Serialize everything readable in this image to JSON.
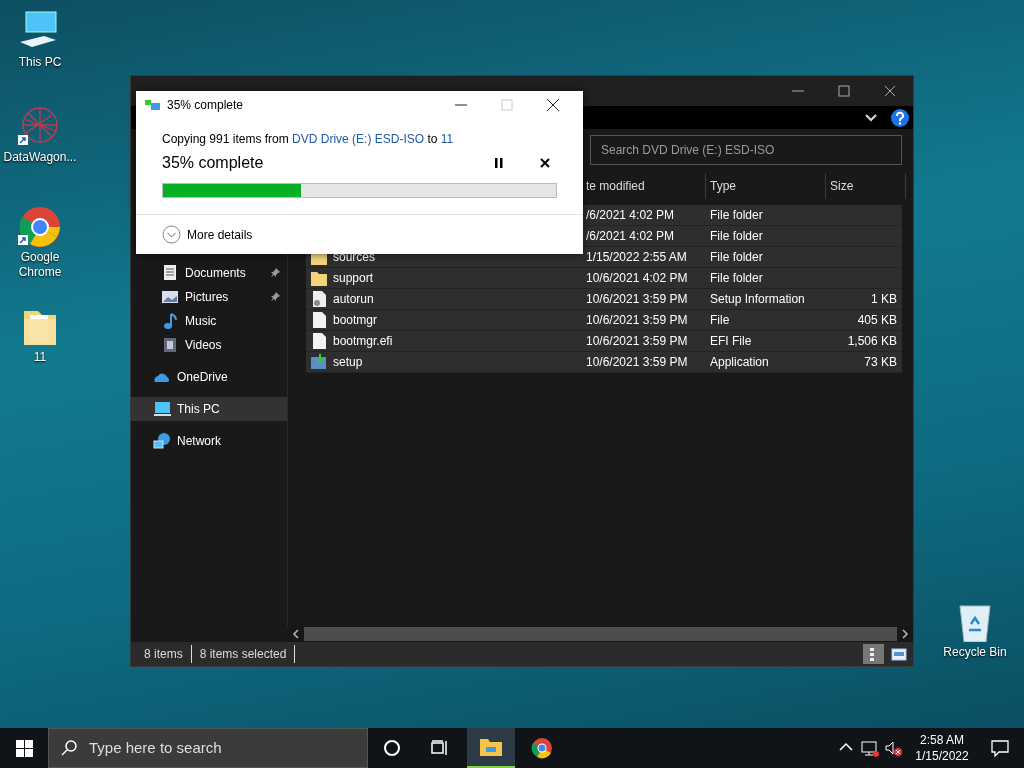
{
  "desktop_icons": [
    {
      "kind": "computer",
      "label": "This PC",
      "shortcut": false
    },
    {
      "kind": "network-app",
      "label": "DataWagon...",
      "shortcut": true
    },
    {
      "kind": "browser",
      "label": "Google Chrome",
      "shortcut": true
    },
    {
      "kind": "folder",
      "label": "11",
      "shortcut": false
    },
    {
      "kind": "recycle",
      "label": "Recycle Bin",
      "shortcut": false
    }
  ],
  "explorer": {
    "search": {
      "placeholder": "Search DVD Drive (E:) ESD-ISO"
    },
    "columns": [
      "te modified",
      "Type",
      "Size"
    ],
    "sidebar": [
      {
        "kind": "documents",
        "label": "Documents",
        "pinned": true,
        "selected": false
      },
      {
        "kind": "pictures",
        "label": "Pictures",
        "pinned": true,
        "selected": false
      },
      {
        "kind": "music",
        "label": "Music",
        "pinned": false,
        "selected": false
      },
      {
        "kind": "videos",
        "label": "Videos",
        "pinned": false,
        "selected": false
      },
      {
        "kind": "cloud",
        "label": "OneDrive",
        "pinned": false,
        "selected": false
      },
      {
        "kind": "computer",
        "label": "This PC",
        "pinned": false,
        "selected": true
      },
      {
        "kind": "network",
        "label": "Network",
        "pinned": false,
        "selected": false
      }
    ],
    "rows": [
      {
        "date": "/6/2021 4:02 PM",
        "type": "File folder",
        "selected": true
      },
      {
        "date": "/6/2021 4:02 PM",
        "type": "File folder",
        "selected": true
      },
      {
        "kind": "folder",
        "name": "sources",
        "date": "1/15/2022 2:55 AM",
        "type": "File folder",
        "selected": true
      },
      {
        "kind": "folder",
        "name": "support",
        "date": "10/6/2021 4:02 PM",
        "type": "File folder",
        "selected": true
      },
      {
        "kind": "settings-file",
        "name": "autorun",
        "date": "10/6/2021 3:59 PM",
        "type": "Setup Information",
        "size": "1 KB",
        "selected": true
      },
      {
        "kind": "file",
        "name": "bootmgr",
        "date": "10/6/2021 3:59 PM",
        "type": "File",
        "size": "405 KB",
        "selected": true
      },
      {
        "kind": "file",
        "name": "bootmgr.efi",
        "date": "10/6/2021 3:59 PM",
        "type": "EFI File",
        "size": "1,506 KB",
        "selected": true
      },
      {
        "kind": "app",
        "name": "setup",
        "date": "10/6/2021 3:59 PM",
        "type": "Application",
        "size": "73 KB",
        "selected": true
      }
    ],
    "status": [
      "8 items",
      "8 items selected"
    ],
    "views": [
      {
        "kind": "details",
        "selected": true
      },
      {
        "kind": "tiles",
        "selected": false
      }
    ]
  },
  "copy_dialog": {
    "title": "35% complete",
    "message": {
      "prefix": "Copying 991 items from",
      "source": "DVD Drive (E:) ESD-ISO",
      "middle": "to",
      "destination": "11"
    },
    "progress_text": "35% complete",
    "level": 0.35,
    "more_details": "More details"
  },
  "taskbar": {
    "search": {
      "placeholder": "Type here to search"
    },
    "apps": [
      {
        "kind": "explorer",
        "active": true
      },
      {
        "kind": "chrome",
        "active": false
      }
    ],
    "time": "2:58 AM",
    "date": "1/15/2022"
  }
}
